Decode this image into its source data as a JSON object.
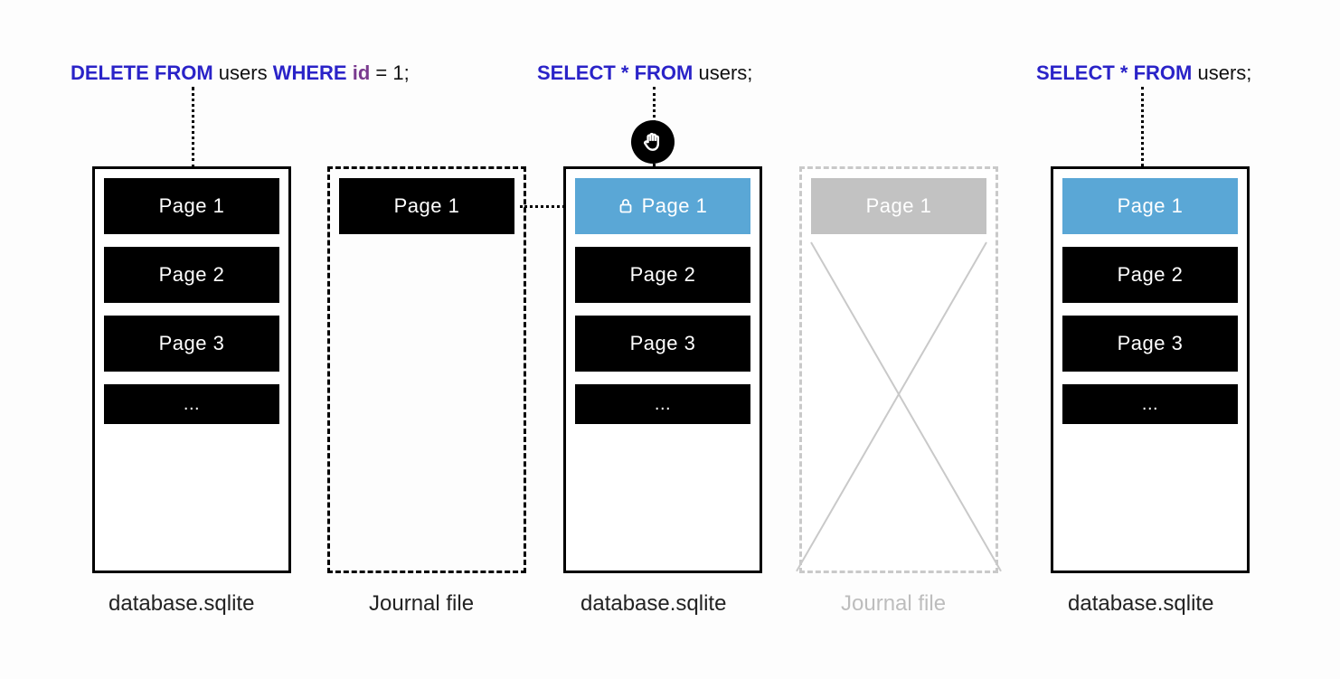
{
  "sql1": {
    "kw_delete": "DELETE FROM",
    "tbl": "users",
    "kw_where": "WHERE",
    "col": "id",
    "rest": " = 1;"
  },
  "sql2": {
    "kw_select": "SELECT * FROM",
    "tbl": "users;"
  },
  "sql3": {
    "kw_select": "SELECT * FROM",
    "tbl": "users;"
  },
  "labels": {
    "page1": "Page 1",
    "page2": "Page 2",
    "page3": "Page 3",
    "ellipsis": "..."
  },
  "captions": {
    "db": "database.sqlite",
    "journal": "Journal file"
  },
  "icons": {
    "stop": "stop-hand-icon",
    "lock": "lock-icon"
  }
}
